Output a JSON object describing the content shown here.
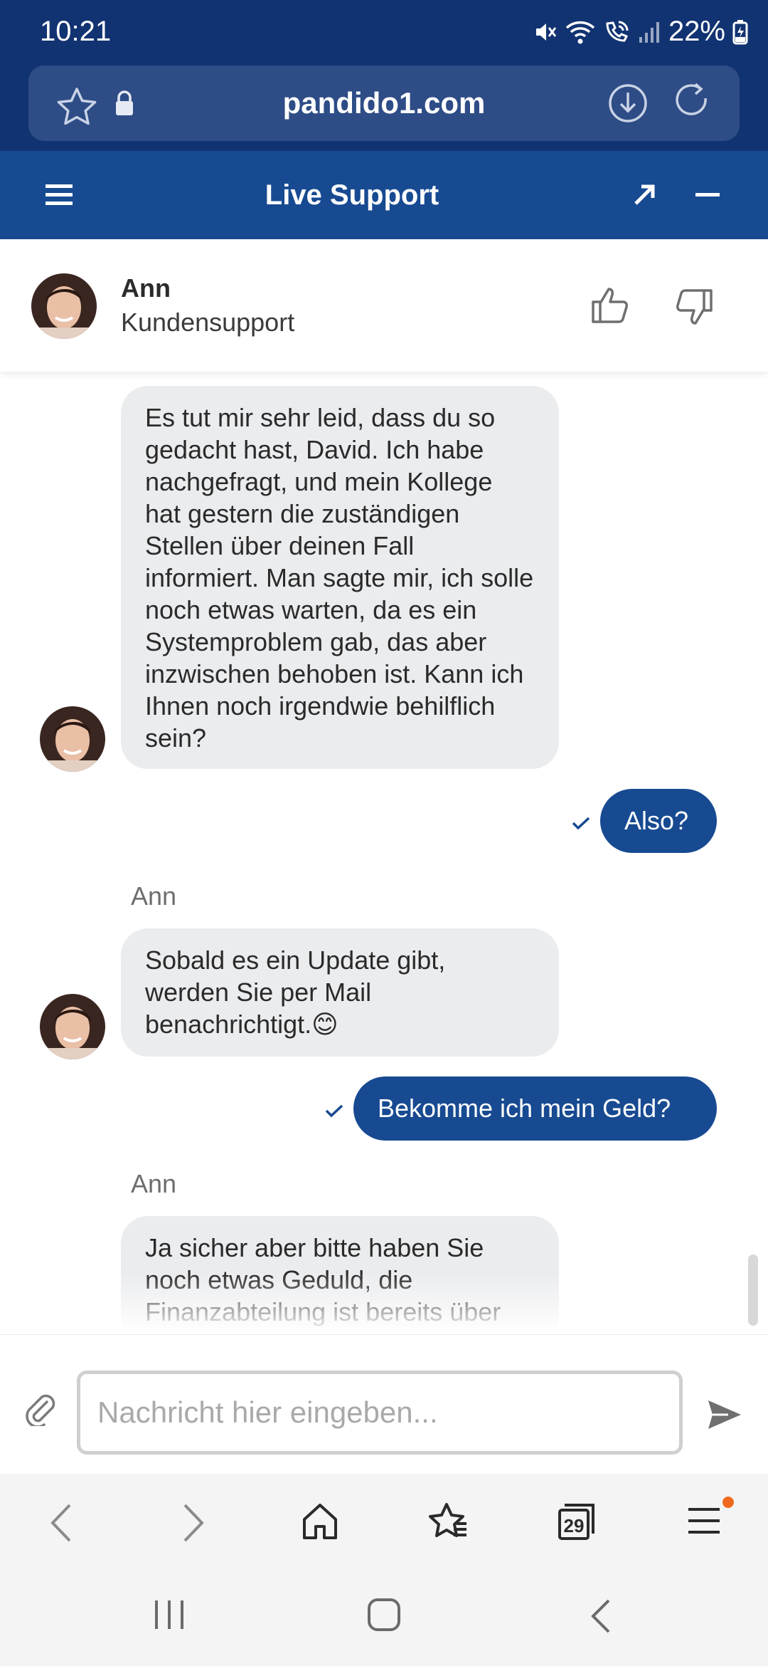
{
  "status_bar": {
    "time": "10:21",
    "battery": "22%"
  },
  "browser": {
    "url": "pandido1.com",
    "tab_count": "29"
  },
  "chat_widget": {
    "title": "Live Support",
    "agent": {
      "name": "Ann",
      "role": "Kundensupport"
    },
    "messages": [
      {
        "from": "agent",
        "text": "Es tut mir sehr leid, dass du so gedacht hast, David. Ich habe nachgefragt, und mein Kollege hat gestern die zuständigen Stellen über deinen Fall informiert. Man sagte mir, ich solle noch etwas warten, da es ein Systemproblem gab, das aber inzwischen behoben ist. Kann ich Ihnen noch irgendwie behilflich sein?"
      },
      {
        "from": "user",
        "text": "Also?"
      },
      {
        "from": "agent",
        "sender": "Ann",
        "text": "Sobald es ein Update gibt, werden Sie per Mail benachrichtigt.😊"
      },
      {
        "from": "user",
        "text": "Bekomme ich mein Geld?"
      },
      {
        "from": "agent",
        "sender": "Ann",
        "text": "Ja sicher aber bitte haben Sie noch etwas Geduld, die Finanzabteilung ist bereits über alle Fälle informiert und arbeitet daran"
      }
    ],
    "input": {
      "placeholder": "Nachricht hier eingeben..."
    }
  },
  "colors": {
    "brand_dark": "#123372",
    "brand": "#174a91",
    "bubble_in": "#ebecee",
    "notification_dot": "#f06a1d"
  }
}
